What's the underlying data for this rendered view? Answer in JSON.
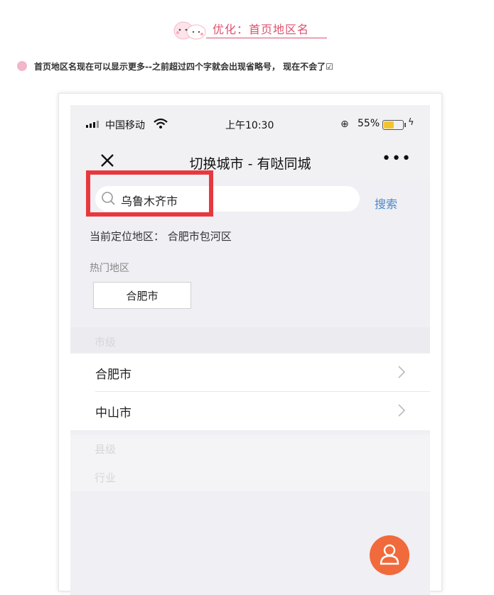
{
  "article": {
    "header_title": "优化：首页地区名",
    "bullet_text": "首页地区名现在可以显示更多--之前超过四个字就会出现省略号， 现在不会了☑"
  },
  "phone": {
    "status": {
      "carrier": "中国移动",
      "time": "上午10:30",
      "battery": "55%",
      "battery_level": 0.55
    },
    "nav": {
      "title": "切换城市 - 有哒同城",
      "close_icon": "close-icon",
      "more_label": "•••"
    },
    "search": {
      "value": "乌鲁木齐市",
      "button_label": "搜索"
    },
    "current_location": "当前定位地区： 合肥市包河区",
    "hot_label": "热门地区",
    "hot_city": "合肥市",
    "section_city": "市级",
    "cities": [
      {
        "name": "合肥市"
      },
      {
        "name": "中山市"
      }
    ],
    "section_county": "县级",
    "section_industry": "行业"
  },
  "colors": {
    "accent_pink": "#e0506f",
    "highlight_red": "#e8383d",
    "link_blue": "#4a88c7",
    "fab_orange": "#f16a3b"
  }
}
